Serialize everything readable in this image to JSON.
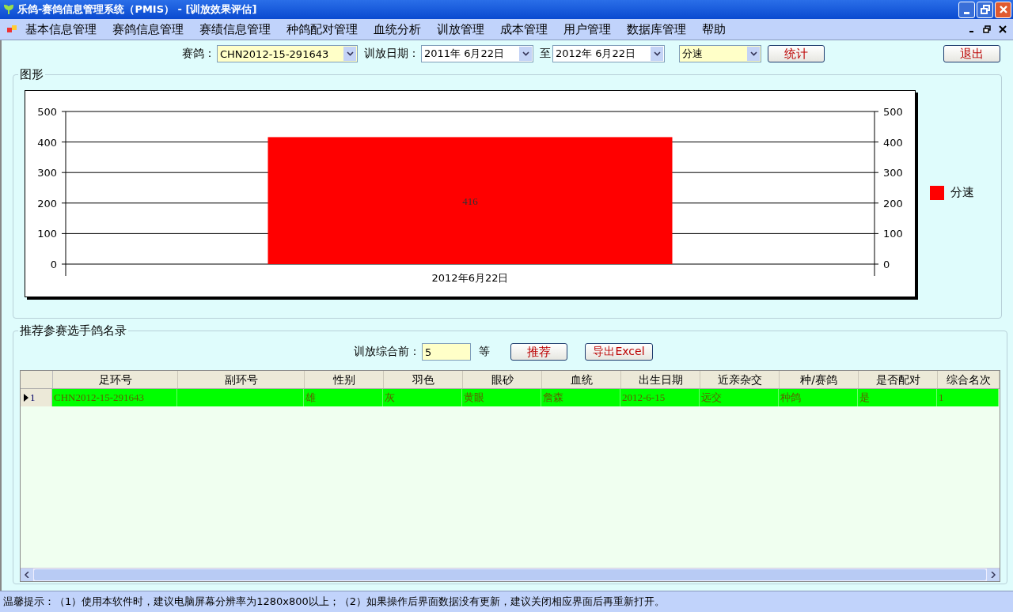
{
  "window": {
    "title": "乐鸽-赛鸽信息管理系统（PMIS） - [训放效果评估]"
  },
  "menu": [
    "基本信息管理",
    "赛鸽信息管理",
    "赛绩信息管理",
    "种鸽配对管理",
    "血统分析",
    "训放管理",
    "成本管理",
    "用户管理",
    "数据库管理",
    "帮助"
  ],
  "filters": {
    "pigeon_label": "赛鸽：",
    "pigeon": "CHN2012-15-291643",
    "date_label": "训放日期：",
    "date_from": "2011年  6月22日",
    "to_label": "至",
    "date_to": "2012年  6月22日",
    "metric": "分速",
    "stat_button": "统计",
    "exit_button": "退出"
  },
  "chart_panel": {
    "title": "图形",
    "chart_data": {
      "type": "bar",
      "categories": [
        "2012年6月22日"
      ],
      "series": [
        {
          "name": "分速",
          "color": "#ff0000",
          "values": [
            416
          ]
        }
      ],
      "ylim": [
        0,
        500
      ],
      "yticks": [
        0,
        100,
        200,
        300,
        400,
        500
      ],
      "grid": true,
      "data_labels": true
    },
    "right_axis_labels": [
      "500",
      "400",
      "300",
      "200",
      "100",
      "0"
    ]
  },
  "recommend": {
    "title": "推荐参赛选手鸽名录",
    "top_label": "训放综合前：",
    "top_value": "5",
    "grade_label": "等",
    "recommend_button": "推荐",
    "export_button": "导出Excel"
  },
  "table": {
    "columns": [
      "足环号",
      "副环号",
      "性别",
      "羽色",
      "眼砂",
      "血统",
      "出生日期",
      "近亲杂交",
      "种/赛鸽",
      "是否配对",
      "综合名次"
    ],
    "rows": [
      {
        "index": "1",
        "selected": true,
        "cells": [
          "CHN2012-15-291643",
          "",
          "雄",
          "灰",
          "黄眼",
          "詹森",
          "2012-6-15",
          "远交",
          "种鸽",
          "是",
          "1"
        ]
      }
    ]
  },
  "status_bar": "温馨提示：（1）使用本软件时，建议电脑屏幕分辨率为1280x800以上；（2）如果操作后界面数据没有更新，建议关闭相应界面后再重新打开。"
}
